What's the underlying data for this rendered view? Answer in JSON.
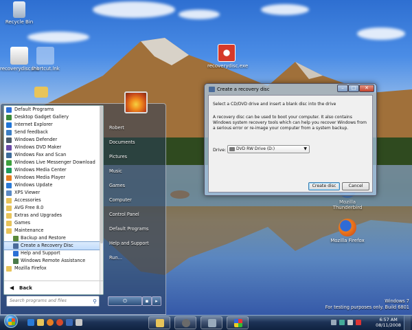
{
  "desktop": {
    "icons": [
      {
        "label": "Recycle Bin"
      },
      {
        "label": "recoverydisc.lnk"
      },
      {
        "label": "shortcut.lnk"
      },
      {
        "label": "recoverydisc.exe"
      },
      {
        "label": "Mozilla Thunderbird"
      },
      {
        "label": "Mozilla Firefox"
      }
    ]
  },
  "start_menu": {
    "programs": [
      {
        "label": "Default Programs",
        "color": "#2b6fd6"
      },
      {
        "label": "Desktop Gadget Gallery",
        "color": "#3a8a3a"
      },
      {
        "label": "Internet Explorer",
        "color": "#1f74d6"
      },
      {
        "label": "Send feedback",
        "color": "#3c7ec4"
      },
      {
        "label": "Windows Defender",
        "color": "#4a5a6a"
      },
      {
        "label": "Windows DVD Maker",
        "color": "#6a4aa8"
      },
      {
        "label": "Windows Fax and Scan",
        "color": "#3c6b9a"
      },
      {
        "label": "Windows Live Messenger Download",
        "color": "#3ca03c"
      },
      {
        "label": "Windows Media Center",
        "color": "#1f9a5a"
      },
      {
        "label": "Windows Media Player",
        "color": "#e67e22"
      },
      {
        "label": "Windows Update",
        "color": "#2a7ad6"
      },
      {
        "label": "XPS Viewer",
        "color": "#5a8ac4"
      },
      {
        "label": "Accessories",
        "folder": true
      },
      {
        "label": "AVG Free 8.0",
        "folder": true
      },
      {
        "label": "Extras and Upgrades",
        "folder": true
      },
      {
        "label": "Games",
        "folder": true
      },
      {
        "label": "Maintenance",
        "folder": true
      },
      {
        "label": "Backup and Restore",
        "sub": true,
        "color": "#5b8a3a"
      },
      {
        "label": "Create a Recovery Disc",
        "sub": true,
        "selected": true,
        "color": "#4a6b9a"
      },
      {
        "label": "Help and Support",
        "sub": true,
        "color": "#2a6fd6"
      },
      {
        "label": "Windows Remote Assistance",
        "sub": true,
        "color": "#4a7a4a"
      },
      {
        "label": "Mozilla Firefox",
        "folder": true
      }
    ],
    "back_label": "Back",
    "search_placeholder": "Search programs and files",
    "right_items": [
      "Robert",
      "Documents",
      "Pictures",
      "Music",
      "Games",
      "Computer",
      "Control Panel",
      "Default Programs",
      "Help and Support",
      "Run..."
    ]
  },
  "dialog": {
    "title": "Create a recovery disc",
    "instruction": "Select a CD/DVD drive and insert a blank disc into the drive",
    "description": "A recovery disc can be used to boot your computer. It also contains Windows system recovery tools which can help you recover Windows from a serious error or re-image your computer from a system backup.",
    "drive_label": "Drive:",
    "drive_value": "DVD RW Drive (D:)",
    "create_button": "Create disc",
    "cancel_button": "Cancel"
  },
  "watermark": {
    "line1": "Windows 7",
    "line2": "For testing purposes only. Build 6801"
  },
  "taskbar": {
    "time": "6:57 AM",
    "date": "08/11/2008"
  }
}
